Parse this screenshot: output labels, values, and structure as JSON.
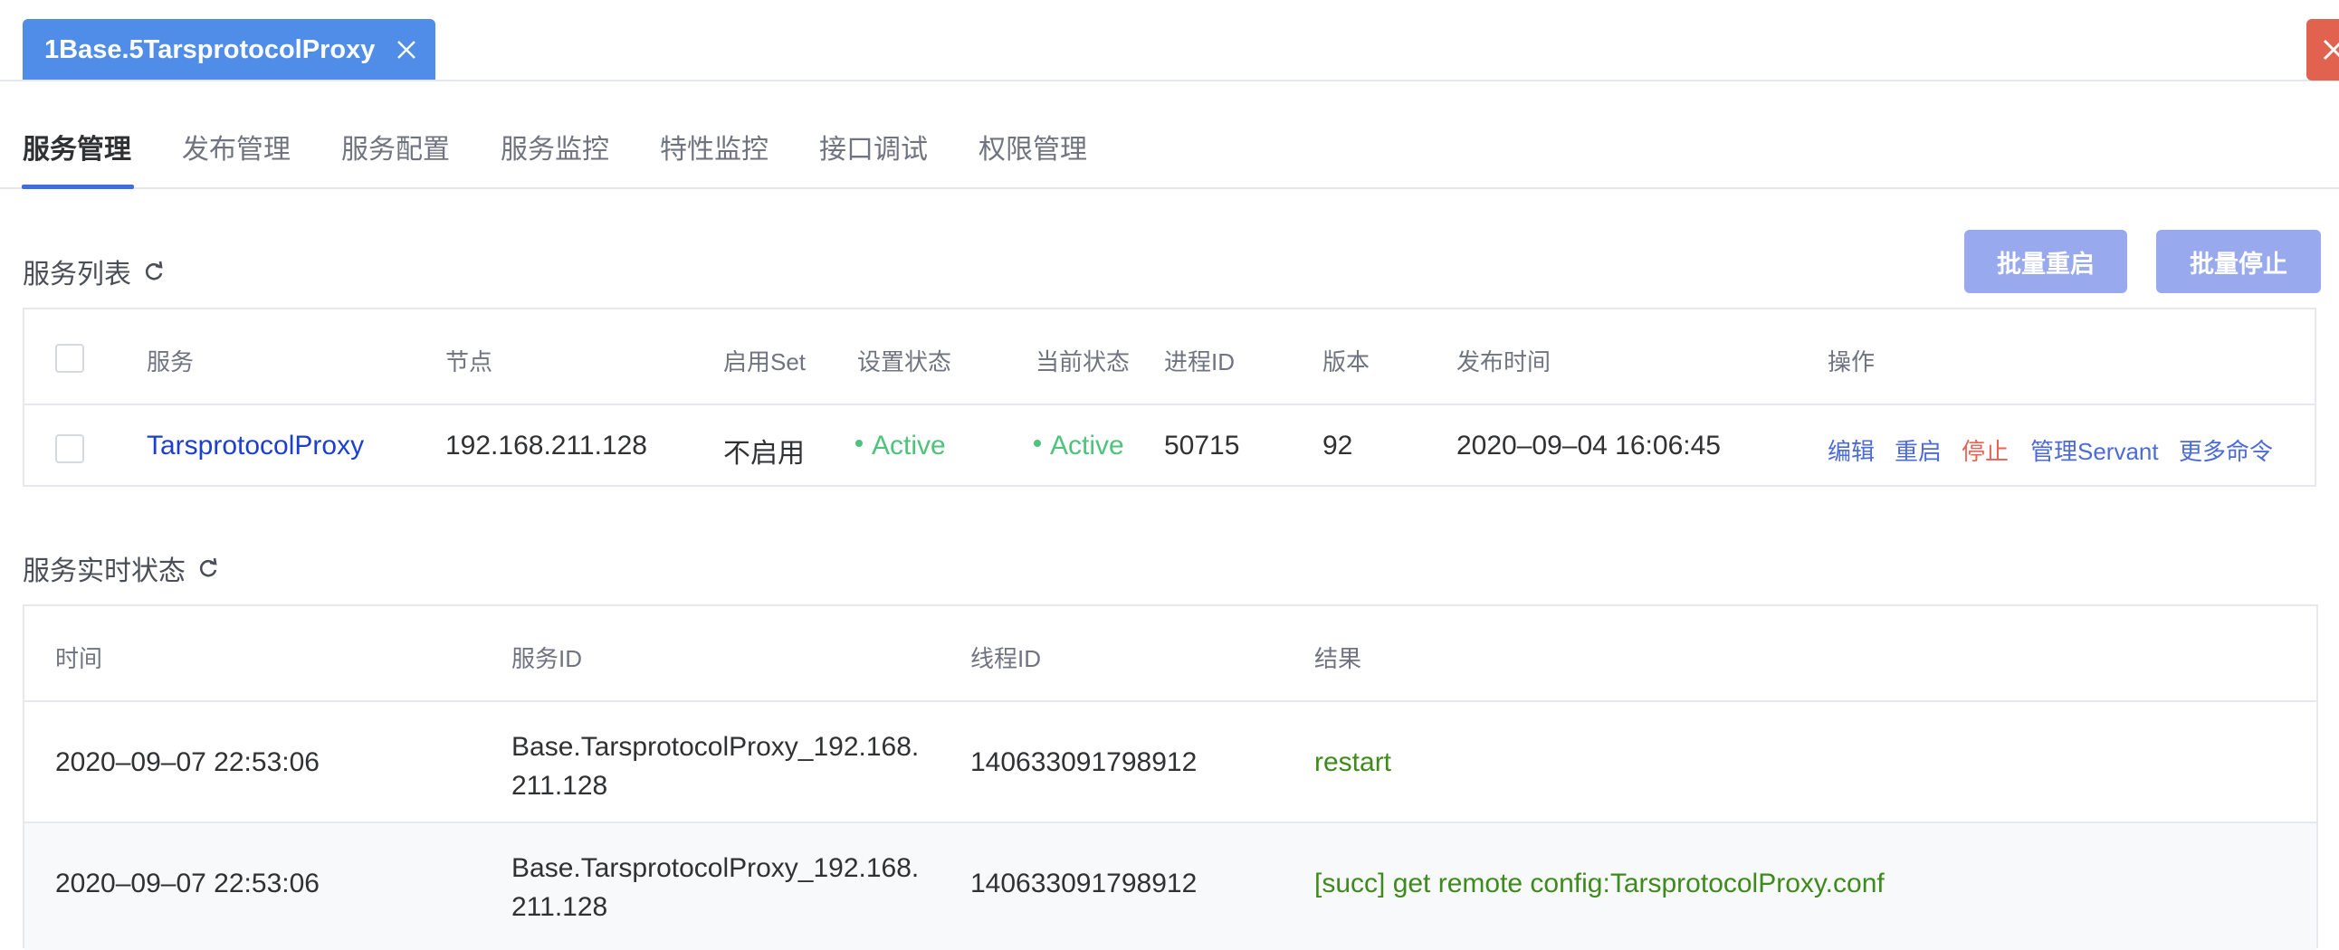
{
  "window": {
    "tab_title": "1Base.5TarsprotocolProxy",
    "close_icon": "close-icon"
  },
  "nav": {
    "tabs": [
      "服务管理",
      "发布管理",
      "服务配置",
      "服务监控",
      "特性监控",
      "接口调试",
      "权限管理"
    ],
    "active": "服务管理"
  },
  "service_list": {
    "title": "服务列表",
    "buttons": {
      "batch_restart": "批量重启",
      "batch_stop": "批量停止"
    },
    "headers": [
      "服务",
      "节点",
      "启用Set",
      "设置状态",
      "当前状态",
      "进程ID",
      "版本",
      "发布时间",
      "操作"
    ],
    "rows": [
      {
        "service": "TarsprotocolProxy",
        "node": "192.168.211.128",
        "set": "不启用",
        "setting_status": "Active",
        "current_status": "Active",
        "pid": "50715",
        "version": "92",
        "publish_time": "2020–09–04 16:06:45",
        "ops": {
          "edit": "编辑",
          "restart": "重启",
          "stop": "停止",
          "servant": "管理Servant",
          "more": "更多命令"
        }
      }
    ]
  },
  "realtime": {
    "title": "服务实时状态",
    "headers": [
      "时间",
      "服务ID",
      "线程ID",
      "结果"
    ],
    "rows": [
      {
        "time": "2020–09–07 22:53:06",
        "service_id_1": "Base.TarsprotocolProxy_192.168.",
        "service_id_2": "211.128",
        "thread_id": "140633091798912",
        "result": "restart"
      },
      {
        "time": "2020–09–07 22:53:06",
        "service_id_1": "Base.TarsprotocolProxy_192.168.",
        "service_id_2": "211.128",
        "thread_id": "140633091798912",
        "result": "[succ] get remote config:TarsprotocolProxy.conf"
      }
    ]
  },
  "colors": {
    "accent": "#4f8de8",
    "button": "#99a9ee",
    "link": "#1d3fd0",
    "active_green": "#4fc27c",
    "stop_red": "#e66355",
    "result_green": "#3e8a1c"
  }
}
